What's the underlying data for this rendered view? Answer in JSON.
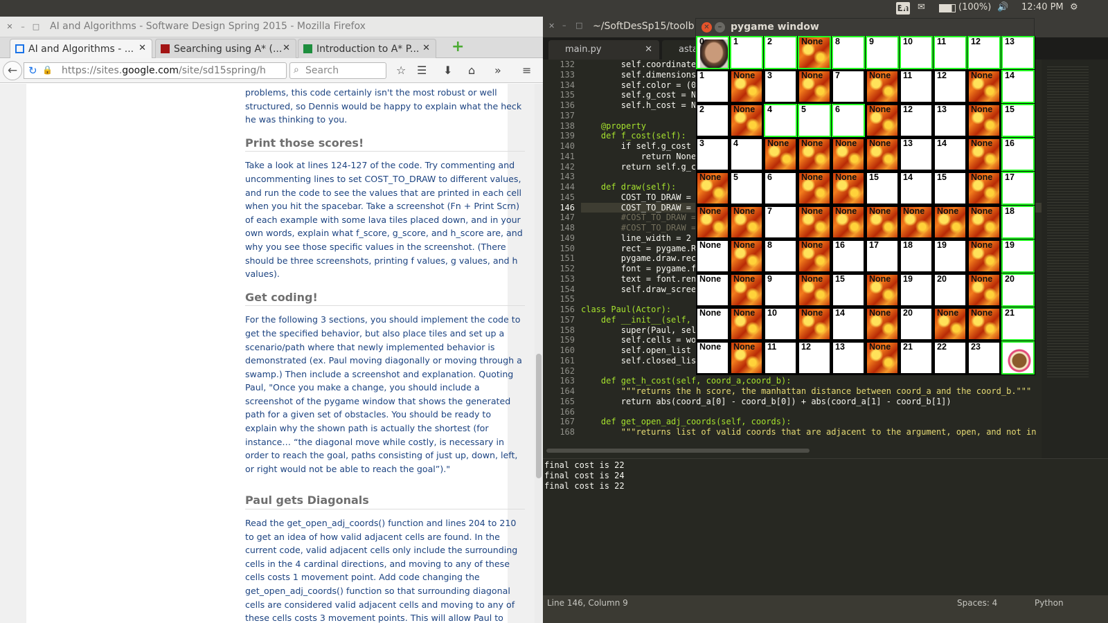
{
  "topbar": {
    "lang": "En",
    "battery": "(100%)",
    "time": "12:40 PM"
  },
  "firefox": {
    "title": "AI and Algorithms - Software Design Spring 2015 - Mozilla Firefox",
    "tabs": [
      {
        "label": "AI and Algorithms - ...",
        "fav": "#1a73e8"
      },
      {
        "label": "Searching using A* (...",
        "fav": "#a31515"
      },
      {
        "label": "Introduction to A* P...",
        "fav": "#1e8e3e"
      }
    ],
    "url_prefix": "https://sites.",
    "url_domain": "google.com",
    "url_rest": "/site/sd15spring/h",
    "search_placeholder": "Search",
    "content": {
      "p0": "problems, this code certainly isn't the most robust or well structured, so Dennis would be happy to explain what the heck he was thinking to you.",
      "h1": "Print those scores!",
      "p1": "Take a look at lines 124-127 of the code. Try commenting and uncommenting lines to set COST_TO_DRAW to different values, and run the code to see the values that are printed in each cell when you hit the spacebar. Take a screenshot (Fn + Print Scrn) of each example with some lava tiles placed down, and in your own words, explain what f_score, g_score, and h_score are, and why you see those specific values in the screenshot. (There should be three screenshots, printing f values, g values, and h values).",
      "h2": "Get coding!",
      "p2": "For the following 3 sections, you should implement the code to get the specified behavior, but also place tiles and set up a scenario/path where that newly implemented behavior is demonstrated (ex. Paul moving diagonally or moving through a swamp.) Then include a screenshot and explanation. Quoting Paul, \"Once you make a change, you should include a screenshot of the pygame window that shows the generated path for a given set of obstacles. You should be ready to explain why the shown path is actually the shortest (for instance… “the diagonal move while costly, is necessary in order to reach the goal, paths consisting of just up, down, left, or right would not be able to reach the goal”).\"",
      "h3": "Paul gets Diagonals",
      "p3": "Read the get_open_adj_coords() function and lines 204 to 210 to get an idea of how valid adjacent cells are found. In the current code, valid adjacent cells only include the surrounding cells in the 4 cardinal directions, and moving to any of these cells costs 1 movement point. Add code changing the get_open_adj_coords() function so that surrounding diagonal cells are considered valid adjacent cells and moving to any of these cells costs 3 movement points. This will allow Paul to move diagonally."
    }
  },
  "sublime": {
    "title": "~/SoftDesSp15/toolb",
    "tabs": [
      "main.py",
      "astar.p"
    ],
    "line_numbers": [
      "132",
      "133",
      "134",
      "135",
      "136",
      "137",
      "138",
      "139",
      "140",
      "141",
      "142",
      "143",
      "144",
      "145",
      "146",
      "147",
      "148",
      "149",
      "150",
      "151",
      "152",
      "153",
      "154",
      "155",
      "156",
      "157",
      "158",
      "159",
      "160",
      "161",
      "162",
      "163",
      "164",
      "165",
      "166",
      "167",
      "168"
    ],
    "code_lines": [
      "        self.coordinates",
      "        self.dimensions",
      "        self.color = (0,",
      "        self.g_cost = No",
      "        self.h_cost = No",
      "",
      "    @property",
      "    def f_cost(self):",
      "        if self.g_cost i",
      "            return None",
      "        return self.g_co",
      "",
      "    def draw(self):",
      "        COST_TO_DRAW = '",
      "        COST_TO_DRAW = s",
      "        #COST_TO_DRAW =",
      "        #COST_TO_DRAW =",
      "        line_width = 2",
      "        rect = pygame.Re",
      "        pygame.draw.rect",
      "        font = pygame.fo",
      "        text = font.rend",
      "        self.draw_screen",
      "",
      "class Paul(Actor):",
      "    def __init__(self, i",
      "        super(Paul, self",
      "        self.cells = wor",
      "        self.open_list =",
      "        self.closed_list",
      "",
      "    def get_h_cost(self, coord_a,coord_b):",
      "        \"\"\"returns the h score, the manhattan distance between coord_a and the coord_b.\"\"\"",
      "        return abs(coord_a[0] - coord_b[0]) + abs(coord_a[1] - coord_b[1])",
      "",
      "    def get_open_adj_coords(self, coords):",
      "        \"\"\"returns list of valid coords that are adjacent to the argument, open, and not in"
    ],
    "console": [
      "final cost is 22",
      "final cost is 24",
      "final cost is 22"
    ],
    "status_left": "Line 146, Column 9",
    "status_spaces": "Spaces: 4",
    "status_lang": "Python"
  },
  "pygame": {
    "title": "pygame window",
    "rows": [
      [
        [
          "0",
          "open",
          "paul"
        ],
        [
          "1",
          "open",
          ""
        ],
        [
          "2",
          "open",
          ""
        ],
        [
          "None",
          "open",
          "lava"
        ],
        [
          "8",
          "open",
          ""
        ],
        [
          "9",
          "open",
          ""
        ],
        [
          "10",
          "open",
          ""
        ],
        [
          "11",
          "open",
          ""
        ],
        [
          "12",
          "open",
          ""
        ],
        [
          "13",
          "open",
          ""
        ]
      ],
      [
        [
          "1",
          "",
          ""
        ],
        [
          "None",
          "",
          "lava"
        ],
        [
          "3",
          "",
          ""
        ],
        [
          "None",
          "",
          "lava"
        ],
        [
          "7",
          "",
          ""
        ],
        [
          "None",
          "",
          "lava"
        ],
        [
          "11",
          "",
          ""
        ],
        [
          "12",
          "",
          ""
        ],
        [
          "None",
          "",
          "lava"
        ],
        [
          "14",
          "open",
          ""
        ]
      ],
      [
        [
          "2",
          "",
          ""
        ],
        [
          "None",
          "",
          "lava"
        ],
        [
          "4",
          "open",
          ""
        ],
        [
          "5",
          "open",
          ""
        ],
        [
          "6",
          "open",
          ""
        ],
        [
          "None",
          "",
          "lava"
        ],
        [
          "12",
          "",
          ""
        ],
        [
          "13",
          "",
          ""
        ],
        [
          "None",
          "",
          "lava"
        ],
        [
          "15",
          "open",
          ""
        ]
      ],
      [
        [
          "3",
          "",
          ""
        ],
        [
          "4",
          "",
          ""
        ],
        [
          "None",
          "",
          "lava"
        ],
        [
          "None",
          "",
          "lava"
        ],
        [
          "None",
          "",
          "lava"
        ],
        [
          "None",
          "",
          "lava"
        ],
        [
          "13",
          "",
          ""
        ],
        [
          "14",
          "",
          ""
        ],
        [
          "None",
          "",
          "lava"
        ],
        [
          "16",
          "open",
          ""
        ]
      ],
      [
        [
          "None",
          "",
          "lava"
        ],
        [
          "5",
          "",
          ""
        ],
        [
          "6",
          "",
          ""
        ],
        [
          "None",
          "",
          "lava"
        ],
        [
          "None",
          "",
          "lava"
        ],
        [
          "15",
          "",
          ""
        ],
        [
          "14",
          "",
          ""
        ],
        [
          "15",
          "",
          ""
        ],
        [
          "None",
          "",
          "lava"
        ],
        [
          "17",
          "open",
          ""
        ]
      ],
      [
        [
          "None",
          "",
          "lava"
        ],
        [
          "None",
          "",
          "lava"
        ],
        [
          "7",
          "",
          ""
        ],
        [
          "None",
          "",
          "lava"
        ],
        [
          "None",
          "",
          "lava"
        ],
        [
          "None",
          "",
          "lava"
        ],
        [
          "None",
          "",
          "lava"
        ],
        [
          "None",
          "",
          "lava"
        ],
        [
          "None",
          "",
          "lava"
        ],
        [
          "18",
          "open",
          ""
        ]
      ],
      [
        [
          "None",
          "",
          ""
        ],
        [
          "None",
          "",
          "lava"
        ],
        [
          "8",
          "",
          ""
        ],
        [
          "None",
          "",
          "lava"
        ],
        [
          "16",
          "",
          ""
        ],
        [
          "17",
          "",
          ""
        ],
        [
          "18",
          "",
          ""
        ],
        [
          "19",
          "",
          ""
        ],
        [
          "None",
          "",
          "lava"
        ],
        [
          "19",
          "open",
          ""
        ]
      ],
      [
        [
          "None",
          "",
          ""
        ],
        [
          "None",
          "",
          "lava"
        ],
        [
          "9",
          "",
          ""
        ],
        [
          "None",
          "",
          "lava"
        ],
        [
          "15",
          "",
          ""
        ],
        [
          "None",
          "",
          "lava"
        ],
        [
          "19",
          "",
          ""
        ],
        [
          "20",
          "",
          ""
        ],
        [
          "None",
          "",
          "lava"
        ],
        [
          "20",
          "open",
          ""
        ]
      ],
      [
        [
          "None",
          "",
          ""
        ],
        [
          "None",
          "",
          "lava"
        ],
        [
          "10",
          "",
          ""
        ],
        [
          "None",
          "",
          "lava"
        ],
        [
          "14",
          "",
          ""
        ],
        [
          "None",
          "",
          "lava"
        ],
        [
          "20",
          "",
          ""
        ],
        [
          "None",
          "",
          "lava"
        ],
        [
          "None",
          "",
          "lava"
        ],
        [
          "21",
          "open",
          ""
        ]
      ],
      [
        [
          "None",
          "",
          ""
        ],
        [
          "None",
          "",
          "lava"
        ],
        [
          "11",
          "",
          ""
        ],
        [
          "12",
          "",
          ""
        ],
        [
          "13",
          "",
          ""
        ],
        [
          "None",
          "",
          "lava"
        ],
        [
          "21",
          "",
          ""
        ],
        [
          "22",
          "",
          ""
        ],
        [
          "23",
          "",
          ""
        ],
        [
          "",
          "open",
          "cake"
        ]
      ]
    ]
  }
}
